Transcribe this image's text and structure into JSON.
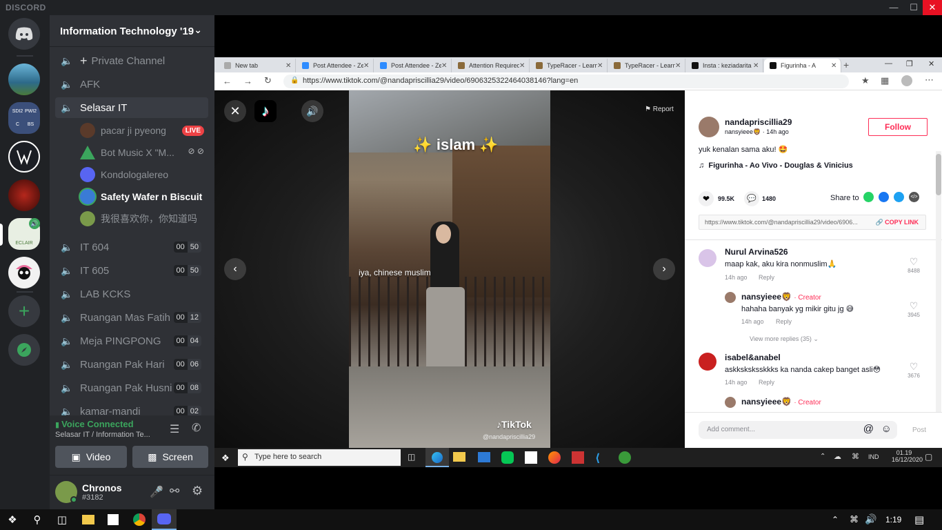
{
  "app": {
    "brand": "DISCORD"
  },
  "guild": {
    "name": "Information Technology '19"
  },
  "channels": [
    {
      "name": "Private Channel"
    },
    {
      "name": "AFK"
    },
    {
      "name": "Selasar IT"
    },
    {
      "name": "IT 604",
      "a": "00",
      "b": "50"
    },
    {
      "name": "IT 605",
      "a": "00",
      "b": "50"
    },
    {
      "name": "LAB KCKS"
    },
    {
      "name": "Ruangan Mas Fatih",
      "a": "00",
      "b": "12"
    },
    {
      "name": "Meja PINGPONG",
      "a": "00",
      "b": "04"
    },
    {
      "name": "Ruangan Pak Hari",
      "a": "00",
      "b": "06"
    },
    {
      "name": "Ruangan Pak Husni",
      "a": "00",
      "b": "08"
    },
    {
      "name": "kamar-mandi",
      "a": "00",
      "b": "02"
    }
  ],
  "voice_users": [
    {
      "name": "pacar ji pyeong",
      "badge": "LIVE"
    },
    {
      "name": "Bot Music X \"M..."
    },
    {
      "name": "Kondologalereo"
    },
    {
      "name": "Safety Wafer n Biscuit"
    },
    {
      "name": "我很喜欢你，你知道吗"
    }
  ],
  "voice": {
    "status": "Voice Connected",
    "location": "Selasar IT / Information Te...",
    "video_label": "Video",
    "screen_label": "Screen"
  },
  "user": {
    "name": "Chronos",
    "tag": "#3182"
  },
  "browser": {
    "tabs": [
      "New tab",
      "Post Attendee - Ze",
      "Post Attendee - Ze",
      "Attention Required",
      "TypeRacer - Learn",
      "TypeRacer - Learn",
      "Insta : keziadarita",
      "Figurinha - A"
    ],
    "url": "https://www.tiktok.com/@nandapriscillia29/video/6906325322464038146?lang=en"
  },
  "video": {
    "report": "Report",
    "sticker": "✨ islam ✨",
    "caption": "iya, chinese muslim",
    "watermark": "TikTok",
    "handle": "@nandapriscillia29"
  },
  "post": {
    "author": "nandapriscillia29",
    "nickname": "nansyieee🦁",
    "time": "14h ago",
    "follow": "Follow",
    "desc": "yuk kenalan sama aku! 🤩",
    "music": "Figurinha - Ao Vivo - Douglas & Vinicius",
    "likes": "99.5K",
    "comments_count": "1480",
    "share_to": "Share to",
    "link": "https://www.tiktok.com/@nandapriscillia29/video/6906...",
    "copy_link": "COPY LINK",
    "add_comment": "Add comment...",
    "post_btn": "Post"
  },
  "comments": [
    {
      "name": "Nurul Arvina526",
      "text": "maap kak, aku kira nonmuslim🙏",
      "time": "14h ago",
      "reply": "Reply",
      "likes": "8488"
    },
    {
      "name": "nansyieee🦁",
      "creator": "· Creator",
      "text": "hahaha banyak yg mikir gitu jg 😅",
      "time": "14h ago",
      "reply": "Reply",
      "likes": "3945"
    },
    {
      "more": "View more replies (35)"
    },
    {
      "name": "isabel&anabel",
      "text": "askksksksskkks ka nanda cakep banget asli😳",
      "time": "14h ago",
      "reply": "Reply",
      "likes": "3676"
    },
    {
      "name": "nansyieee🦁",
      "creator": "· Creator"
    }
  ],
  "inner_taskbar": {
    "search": "Type here to search",
    "lang": "IND",
    "time": "01.19",
    "date": "16/12/2020"
  },
  "taskbar": {
    "time": "1:19"
  }
}
